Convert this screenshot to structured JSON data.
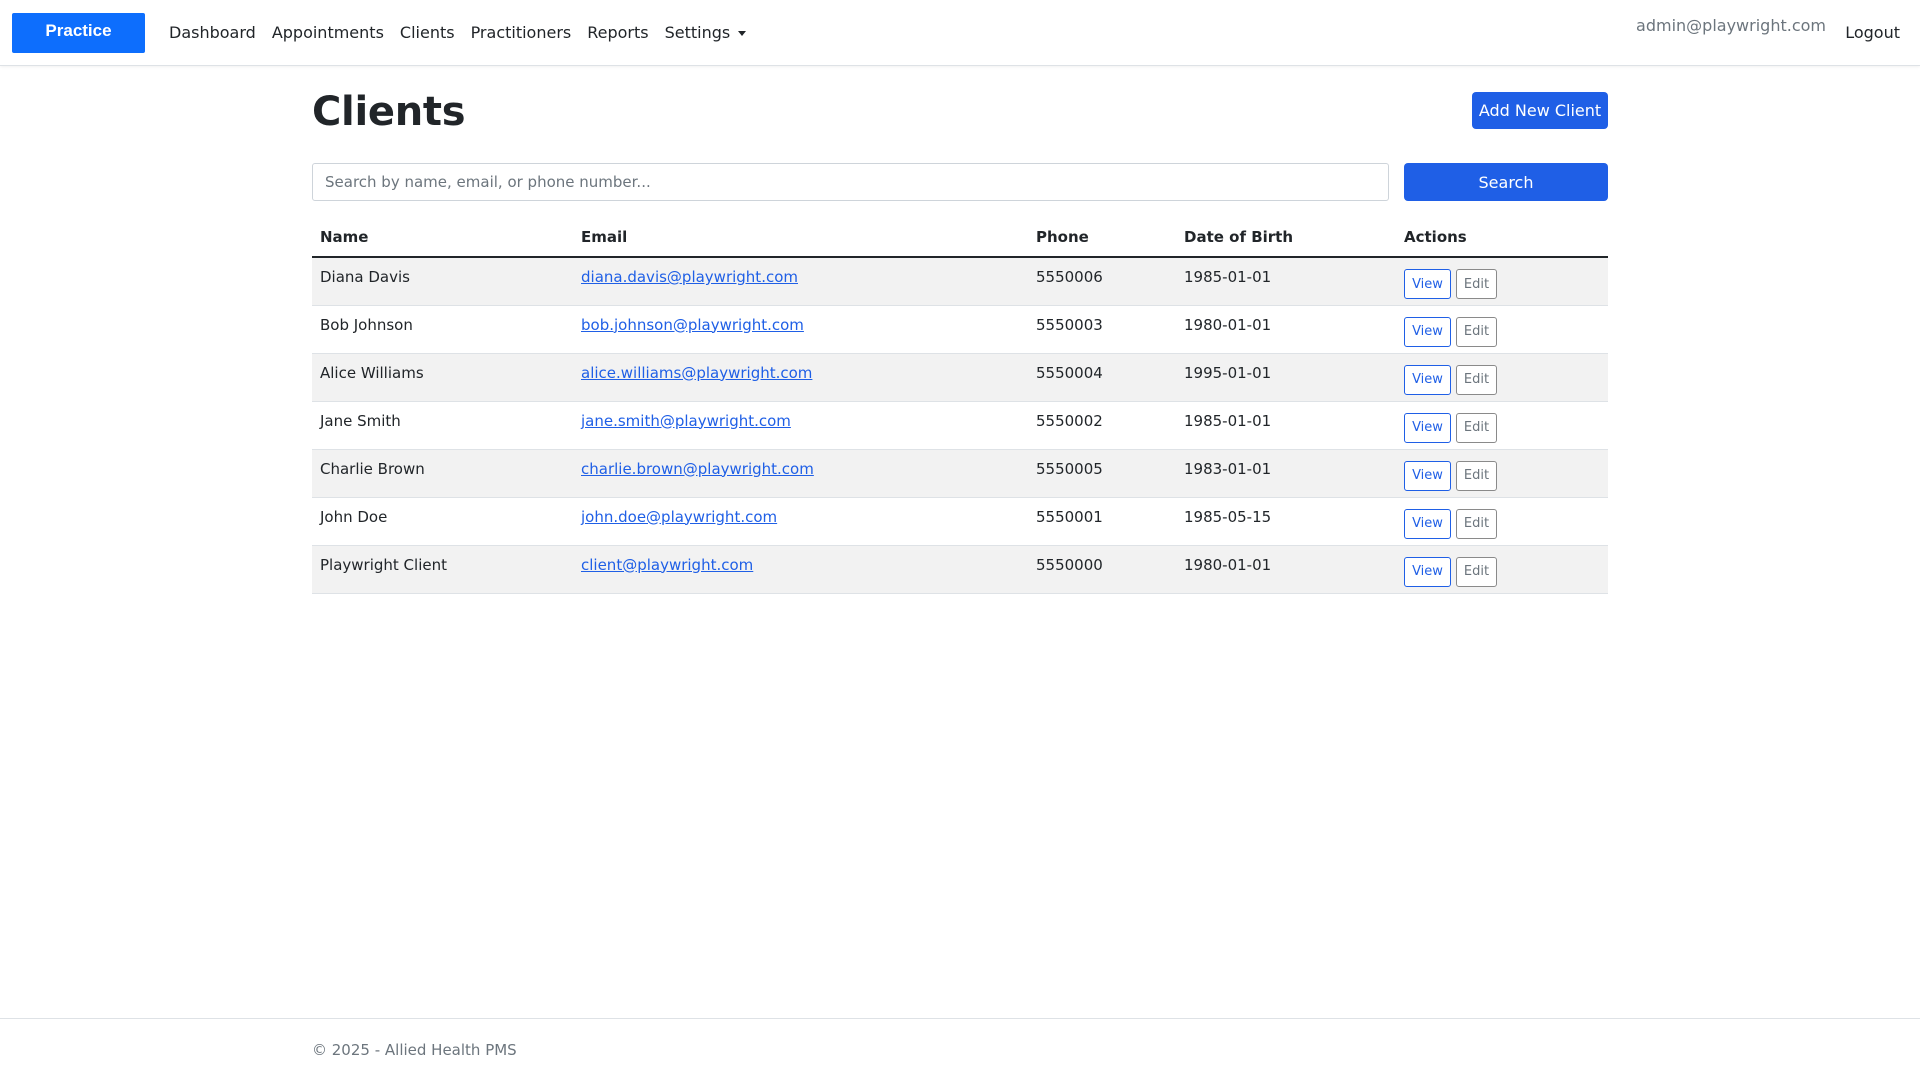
{
  "navbar": {
    "brand": "Practice",
    "links": [
      "Dashboard",
      "Appointments",
      "Clients",
      "Practitioners",
      "Reports",
      "Settings"
    ],
    "user": "admin@playwright.com",
    "logout": "Logout"
  },
  "page": {
    "title": "Clients",
    "add_button": "Add New Client",
    "search_placeholder": "Search by name, email, or phone number...",
    "search_value": "",
    "search_button": "Search"
  },
  "table": {
    "headers": [
      "Name",
      "Email",
      "Phone",
      "Date of Birth",
      "Actions"
    ],
    "view_label": "View",
    "edit_label": "Edit",
    "rows": [
      {
        "name": "Diana Davis",
        "email": "diana.davis@playwright.com",
        "phone": "5550006",
        "dob": "1985-01-01"
      },
      {
        "name": "Bob Johnson",
        "email": "bob.johnson@playwright.com",
        "phone": "5550003",
        "dob": "1980-01-01"
      },
      {
        "name": "Alice Williams",
        "email": "alice.williams@playwright.com",
        "phone": "5550004",
        "dob": "1995-01-01"
      },
      {
        "name": "Jane Smith",
        "email": "jane.smith@playwright.com",
        "phone": "5550002",
        "dob": "1985-01-01"
      },
      {
        "name": "Charlie Brown",
        "email": "charlie.brown@playwright.com",
        "phone": "5550005",
        "dob": "1983-01-01"
      },
      {
        "name": "John Doe",
        "email": "john.doe@playwright.com",
        "phone": "5550001",
        "dob": "1985-05-15"
      },
      {
        "name": "Playwright Client",
        "email": "client@playwright.com",
        "phone": "5550000",
        "dob": "1980-01-01"
      }
    ]
  },
  "footer": {
    "text": "© 2025 - Allied Health PMS"
  },
  "colors": {
    "brand": "#0d6efd",
    "primary": "#1f5fe6",
    "stripe": "#f2f2f2"
  }
}
